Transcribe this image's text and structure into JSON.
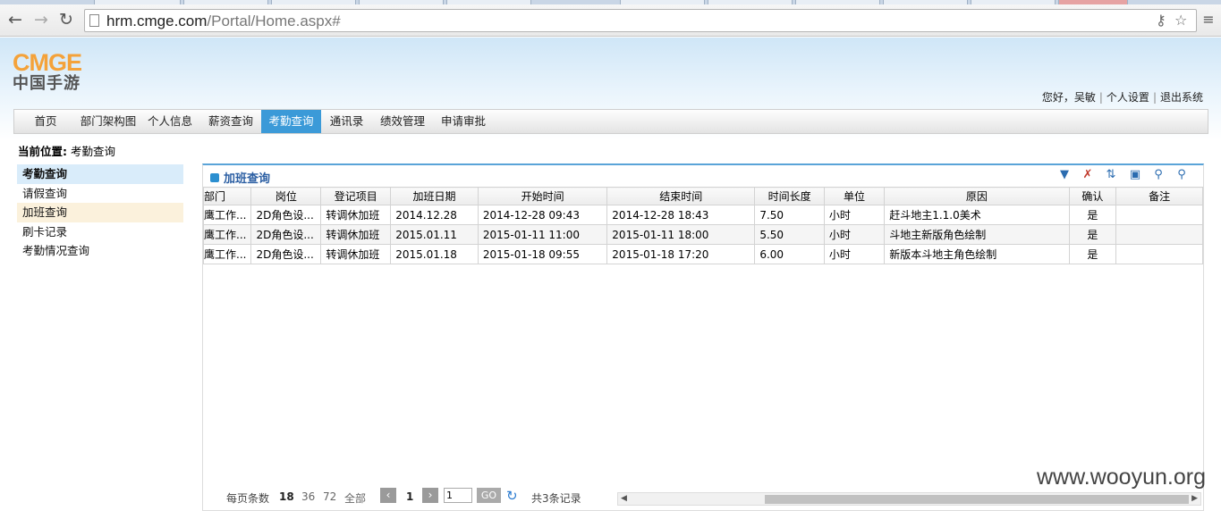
{
  "browser": {
    "url_host": "hrm.cmge.com",
    "url_path": "/Portal/Home.aspx#"
  },
  "logo": {
    "en": "CMGE",
    "cn": "中国手游"
  },
  "userbar": {
    "greeting": "您好，吴敏",
    "settings": "个人设置",
    "logout": "退出系统"
  },
  "nav": [
    "首页",
    "部门架构图",
    "个人信息",
    "薪资查询",
    "考勤查询",
    "通讯录",
    "绩效管理",
    "申请审批"
  ],
  "nav_active": "考勤查询",
  "breadcrumb": {
    "label": "当前位置:",
    "value": "考勤查询"
  },
  "sidebar": [
    "考勤查询",
    "请假查询",
    "加班查询",
    "刷卡记录",
    "考勤情况查询"
  ],
  "panel": {
    "title": "加班查询"
  },
  "table": {
    "headers": [
      "部门",
      "岗位",
      "登记项目",
      "加班日期",
      "开始时间",
      "结束时间",
      "时间长度",
      "单位",
      "原因",
      "确认",
      "备注"
    ],
    "rows": [
      [
        "鹰工作...",
        "2D角色设...",
        "转调休加班",
        "2014.12.28",
        "2014-12-28 09:43",
        "2014-12-28 18:43",
        "7.50",
        "小时",
        "赶斗地主1.1.0美术",
        "是",
        ""
      ],
      [
        "鹰工作...",
        "2D角色设...",
        "转调休加班",
        "2015.01.11",
        "2015-01-11 11:00",
        "2015-01-11 18:00",
        "5.50",
        "小时",
        "斗地主新版角色绘制",
        "是",
        ""
      ],
      [
        "鹰工作...",
        "2D角色设...",
        "转调休加班",
        "2015.01.18",
        "2015-01-18 09:55",
        "2015-01-18 17:20",
        "6.00",
        "小时",
        "新版本斗地主角色绘制",
        "是",
        ""
      ]
    ]
  },
  "pager": {
    "per_page_label": "每页条数",
    "sizes": [
      "18",
      "36",
      "72",
      "全部"
    ],
    "current_page": "1",
    "input_value": "1",
    "go": "GO",
    "total": "共3条记录"
  },
  "watermark": "www.wooyun.org",
  "colors": {
    "accent": "#3b9ad8",
    "logo": "#f4a23a",
    "title": "#2c5fa3"
  }
}
